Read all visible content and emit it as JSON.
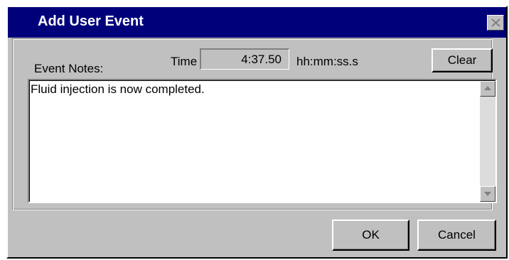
{
  "dialog": {
    "title": "Add User Event",
    "close_icon": "close-icon"
  },
  "event_notes": {
    "label": "Event Notes:",
    "text": "Fluid injection is now completed."
  },
  "time": {
    "label": "Time",
    "value": "4:37.50",
    "format": "hh:mm:ss.s"
  },
  "buttons": {
    "clear": "Clear",
    "ok": "OK",
    "cancel": "Cancel"
  },
  "colors": {
    "titlebar": "#00007b",
    "face": "#c0c0c0"
  },
  "icons": {
    "scroll_up": "scroll-up-arrow-icon",
    "scroll_down": "scroll-down-arrow-icon"
  }
}
